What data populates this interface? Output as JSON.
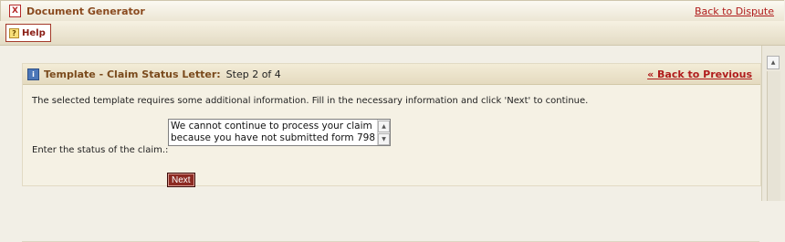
{
  "app": {
    "title": "Document Generator",
    "icon_glyph": "X",
    "back_link": "Back to Dispute"
  },
  "toolbar": {
    "help_label": "Help",
    "help_icon_glyph": "?"
  },
  "panel": {
    "title": "Template - Claim Status Letter:",
    "step": "Step 2 of 4",
    "back_link": "« Back to Previous",
    "instructions": "The selected template requires some additional information. Fill in the necessary information and click 'Next' to continue.",
    "field_label": "Enter the status of the claim.:",
    "field_value": "We cannot continue to process your claim because you have not submitted form 798",
    "next_label": "Next",
    "info_icon_glyph": "i"
  },
  "colors": {
    "link_red": "#b01c1c",
    "title_brown": "#7a4a1c",
    "button_maroon": "#8c2a22"
  }
}
